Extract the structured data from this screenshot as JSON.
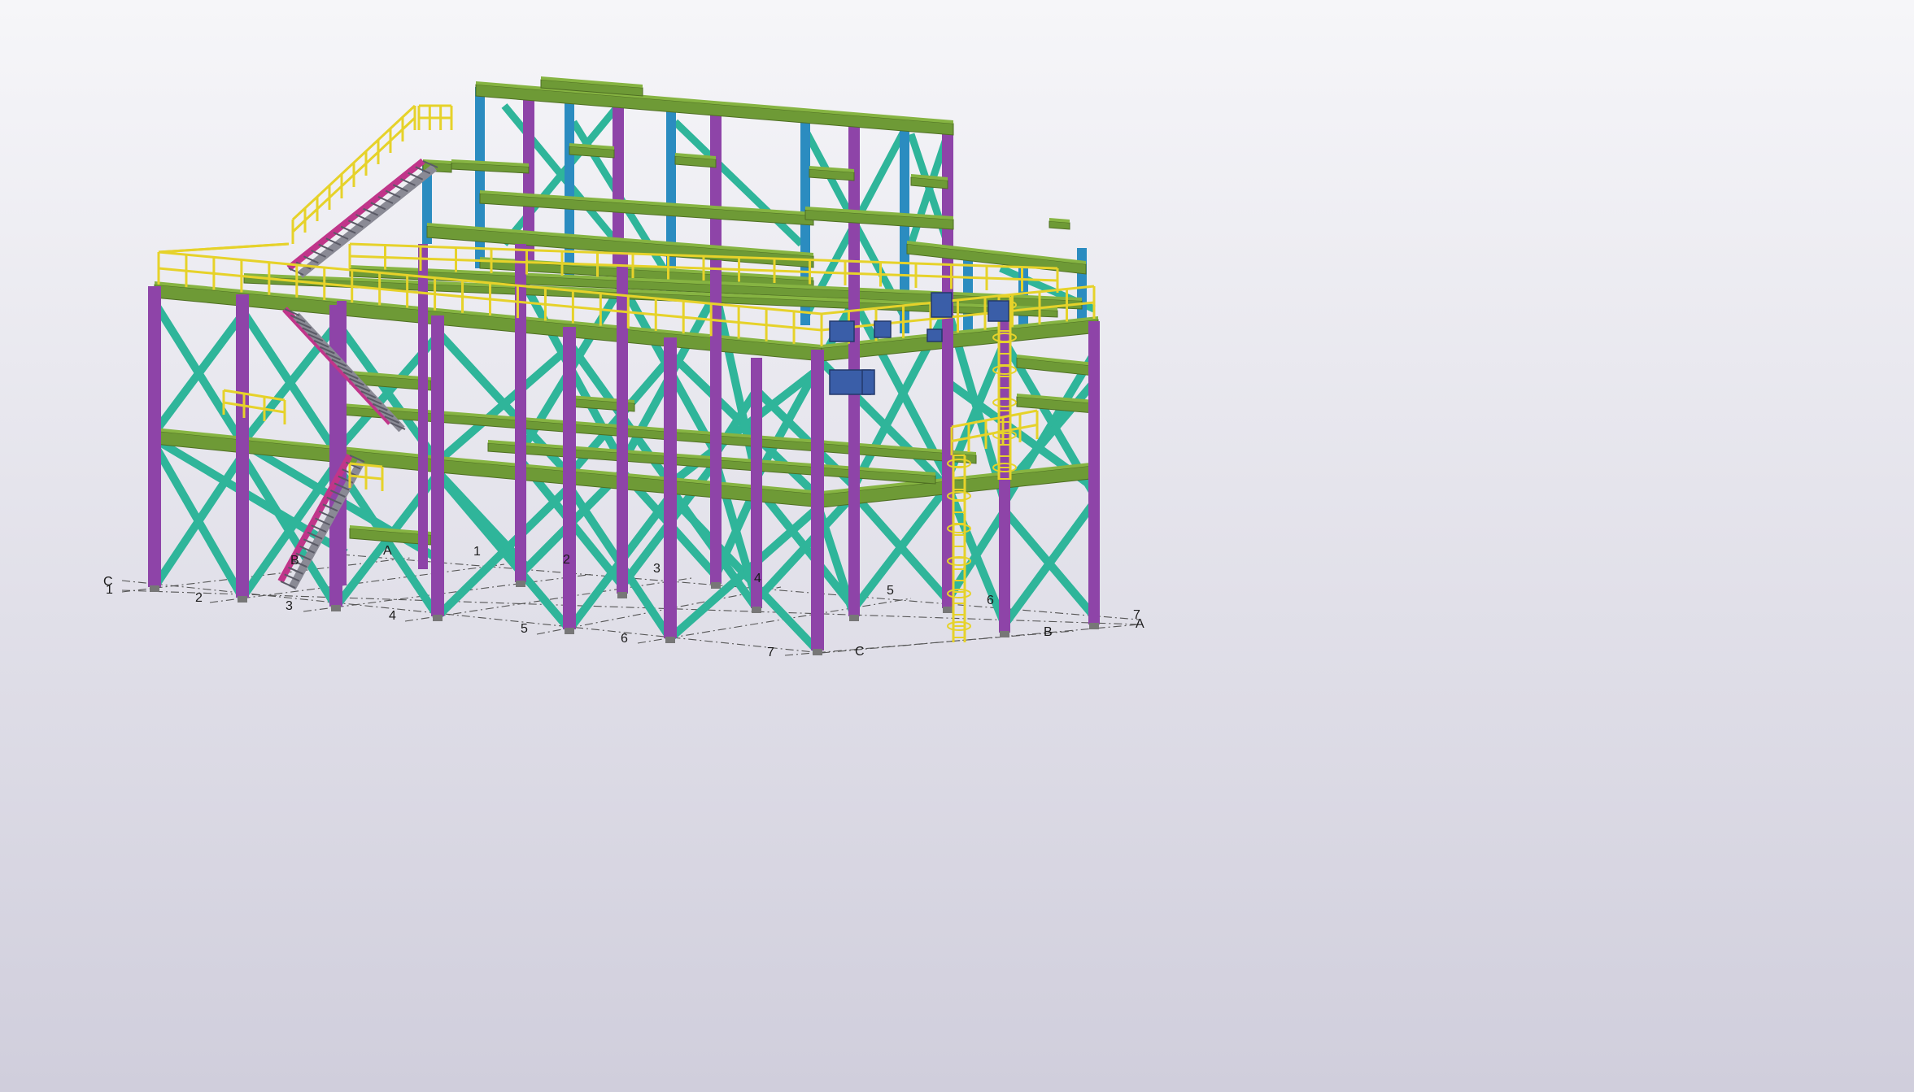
{
  "scene": {
    "description_icon": "steel-structure-model",
    "background_top": "#f4f4f8",
    "background_bottom": "#d2d0de"
  },
  "colors": {
    "beam": "#6e9a36",
    "beam_top": "#86b442",
    "column": "#8e44a8",
    "brace": "#2fb59a",
    "upper_column": "#2b8cc0",
    "stair_stringer": "#c0358a",
    "handrail": "#e6d22a",
    "equipment": "#3a5ea8",
    "grid_line": "#555555"
  },
  "grid": {
    "numbered_axis_front": [
      "1",
      "2",
      "3",
      "4",
      "5",
      "6",
      "7"
    ],
    "numbered_axis_back": [
      "1",
      "2",
      "3",
      "4",
      "5",
      "6",
      "7"
    ],
    "lettered_axis_left": [
      "C",
      "B",
      "A"
    ],
    "lettered_axis_right": [
      "A",
      "B",
      "C"
    ]
  }
}
